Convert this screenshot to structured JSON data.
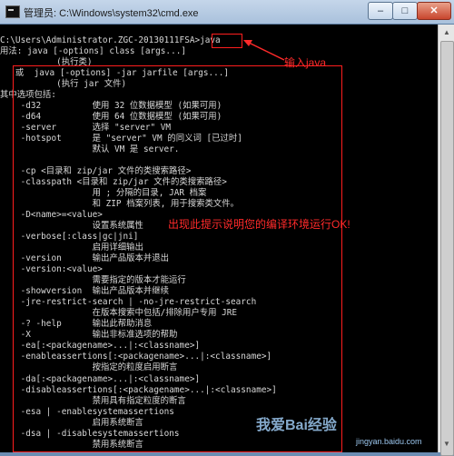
{
  "window": {
    "title": "管理员: C:\\Windows\\system32\\cmd.exe",
    "controls": {
      "minimize": "–",
      "maximize": "□",
      "close": "✕"
    }
  },
  "console": {
    "lines": [
      "",
      "C:\\Users\\Administrator.ZGC-20130111FSA>java",
      "用法: java [-options] class [args...]",
      "           (执行类)",
      "   或  java [-options] -jar jarfile [args...]",
      "           (执行 jar 文件)",
      "其中选项包括:",
      "    -d32          使用 32 位数据模型 (如果可用)",
      "    -d64          使用 64 位数据模型 (如果可用)",
      "    -server       选择 \"server\" VM",
      "    -hotspot      是 \"server\" VM 的同义词 [已过时]",
      "                  默认 VM 是 server.",
      "",
      "    -cp <目录和 zip/jar 文件的类搜索路径>",
      "    -classpath <目录和 zip/jar 文件的类搜索路径>",
      "                  用 ; 分隔的目录, JAR 档案",
      "                  和 ZIP 档案列表, 用于搜索类文件。",
      "    -D<name>=<value>",
      "                  设置系统属性",
      "    -verbose[:class|gc|jni]",
      "                  启用详细输出",
      "    -version      输出产品版本并退出",
      "    -version:<value>",
      "                  需要指定的版本才能运行",
      "    -showversion  输出产品版本并继续",
      "    -jre-restrict-search | -no-jre-restrict-search",
      "                  在版本搜索中包括/排除用户专用 JRE",
      "    -? -help      输出此帮助消息",
      "    -X            输出非标准选项的帮助",
      "    -ea[:<packagename>...|:<classname>]",
      "    -enableassertions[:<packagename>...|:<classname>]",
      "                  按指定的粒度启用断言",
      "    -da[:<packagename>...|:<classname>]",
      "    -disableassertions[:<packagename>...|:<classname>]",
      "                  禁用具有指定粒度的断言",
      "    -esa | -enablesystemassertions",
      "                  启用系统断言",
      "    -dsa | -disablesystemassertions",
      "                  禁用系统断言"
    ]
  },
  "annotations": {
    "input_label": "输入java",
    "ok_label": "出现此提示说明您的编译环境运行OK!",
    "color": "#ff2a2a"
  },
  "watermark": {
    "text": "我爱Bai经验",
    "url": "jingyan.baidu.com"
  }
}
